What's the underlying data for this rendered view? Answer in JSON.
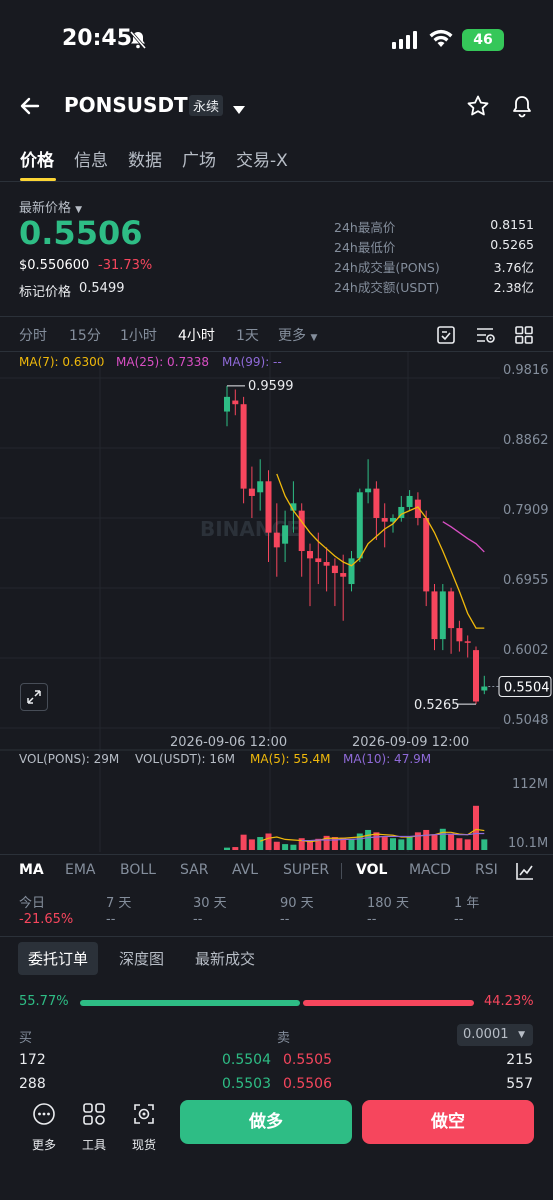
{
  "status_bar": {
    "time": "20:45",
    "battery": "46"
  },
  "header": {
    "symbol": "PONSUSDT",
    "contract_type": "永续"
  },
  "tabs": [
    "价格",
    "信息",
    "数据",
    "广场",
    "交易-X"
  ],
  "price": {
    "label": "最新价格",
    "last": "0.5506",
    "usd": "$0.550600",
    "change": "-31.73%",
    "mark_label": "标记价格",
    "mark_value": "0.5499"
  },
  "stats": [
    {
      "k": "24h最高价",
      "v": "0.8151"
    },
    {
      "k": "24h最低价",
      "v": "0.5265"
    },
    {
      "k": "24h成交量(PONS)",
      "v": "3.76亿"
    },
    {
      "k": "24h成交额(USDT)",
      "v": "2.38亿"
    }
  ],
  "intervals": [
    "分时",
    "15分",
    "1小时",
    "4小时",
    "1天",
    "更多"
  ],
  "active_interval": "4小时",
  "ma_legend": {
    "ma7": "MA(7): 0.6300",
    "ma25": "MA(25): 0.7338",
    "ma99": "MA(99): --"
  },
  "chart": {
    "y_ticks": [
      "0.9816",
      "0.8862",
      "0.7909",
      "0.6955",
      "0.6002",
      "0.5048"
    ],
    "high_label": "0.9599",
    "low_label": "0.5265",
    "current_tag": "0.5504",
    "x_labels": [
      "2026-09-06 12:00",
      "2026-09-09 12:00"
    ],
    "watermark": "BINANCE",
    "vol_ticks": [
      "112M",
      "10.1M"
    ]
  },
  "vol_legend": {
    "pons": "VOL(PONS): 29M",
    "usdt": "VOL(USDT): 16M",
    "ma5": "MA(5): 55.4M",
    "ma10": "MA(10): 47.9M"
  },
  "indicators": [
    "MA",
    "EMA",
    "BOLL",
    "SAR",
    "AVL",
    "SUPER",
    "VOL",
    "MACD",
    "RSI"
  ],
  "performance": [
    {
      "label": "今日",
      "value": "-21.65%"
    },
    {
      "label": "7 天",
      "value": "--"
    },
    {
      "label": "30 天",
      "value": "--"
    },
    {
      "label": "90 天",
      "value": "--"
    },
    {
      "label": "180 天",
      "value": "--"
    },
    {
      "label": "1 年",
      "value": "--"
    }
  ],
  "orderbook_tabs": [
    "委托订单",
    "深度图",
    "最新成交"
  ],
  "ratio": {
    "buy": "55.77%",
    "sell": "44.23%",
    "buy_fraction": 0.5577
  },
  "book": {
    "buy_header": "买",
    "sell_header": "卖",
    "precision": "0.0001",
    "rows": [
      {
        "bid_qty": "172",
        "bid_price": "0.5504",
        "ask_price": "0.5505",
        "ask_qty": "215"
      },
      {
        "bid_qty": "288",
        "bid_price": "0.5503",
        "ask_price": "0.5506",
        "ask_qty": "557"
      }
    ]
  },
  "bottom": {
    "more": "更多",
    "tools": "工具",
    "spot": "现货",
    "long": "做多",
    "short": "做空"
  },
  "colors": {
    "up": "#2ebd85",
    "down": "#f6465d",
    "ma7": "#f0b90b",
    "ma25": "#d94fc4",
    "ma99": "#8f6ad8",
    "accent": "#fcd535"
  },
  "chart_data": {
    "type": "candlestick",
    "y_range": [
      0.5048,
      0.9816
    ],
    "candles": [
      {
        "o": 0.925,
        "c": 0.945,
        "h": 0.96,
        "l": 0.905
      },
      {
        "o": 0.94,
        "c": 0.935,
        "h": 0.955,
        "l": 0.92
      },
      {
        "o": 0.935,
        "c": 0.82,
        "h": 0.945,
        "l": 0.8
      },
      {
        "o": 0.82,
        "c": 0.81,
        "h": 0.85,
        "l": 0.78
      },
      {
        "o": 0.815,
        "c": 0.83,
        "h": 0.86,
        "l": 0.79
      },
      {
        "o": 0.83,
        "c": 0.76,
        "h": 0.845,
        "l": 0.72
      },
      {
        "o": 0.76,
        "c": 0.74,
        "h": 0.8,
        "l": 0.7
      },
      {
        "o": 0.745,
        "c": 0.77,
        "h": 0.79,
        "l": 0.72
      },
      {
        "o": 0.79,
        "c": 0.8,
        "h": 0.83,
        "l": 0.76
      },
      {
        "o": 0.79,
        "c": 0.735,
        "h": 0.8,
        "l": 0.7
      },
      {
        "o": 0.735,
        "c": 0.725,
        "h": 0.745,
        "l": 0.66
      },
      {
        "o": 0.725,
        "c": 0.72,
        "h": 0.76,
        "l": 0.69
      },
      {
        "o": 0.72,
        "c": 0.715,
        "h": 0.74,
        "l": 0.68
      },
      {
        "o": 0.715,
        "c": 0.705,
        "h": 0.725,
        "l": 0.66
      },
      {
        "o": 0.705,
        "c": 0.7,
        "h": 0.73,
        "l": 0.64
      },
      {
        "o": 0.69,
        "c": 0.725,
        "h": 0.735,
        "l": 0.68
      },
      {
        "o": 0.725,
        "c": 0.815,
        "h": 0.82,
        "l": 0.72
      },
      {
        "o": 0.815,
        "c": 0.82,
        "h": 0.86,
        "l": 0.8
      },
      {
        "o": 0.82,
        "c": 0.78,
        "h": 0.83,
        "l": 0.75
      },
      {
        "o": 0.78,
        "c": 0.775,
        "h": 0.8,
        "l": 0.74
      },
      {
        "o": 0.775,
        "c": 0.78,
        "h": 0.785,
        "l": 0.76
      },
      {
        "o": 0.78,
        "c": 0.795,
        "h": 0.81,
        "l": 0.775
      },
      {
        "o": 0.795,
        "c": 0.81,
        "h": 0.818,
        "l": 0.79
      },
      {
        "o": 0.805,
        "c": 0.78,
        "h": 0.815,
        "l": 0.77
      },
      {
        "o": 0.78,
        "c": 0.68,
        "h": 0.79,
        "l": 0.66
      },
      {
        "o": 0.68,
        "c": 0.615,
        "h": 0.69,
        "l": 0.6
      },
      {
        "o": 0.615,
        "c": 0.68,
        "h": 0.69,
        "l": 0.6
      },
      {
        "o": 0.68,
        "c": 0.63,
        "h": 0.685,
        "l": 0.595
      },
      {
        "o": 0.63,
        "c": 0.612,
        "h": 0.64,
        "l": 0.598
      },
      {
        "o": 0.612,
        "c": 0.61,
        "h": 0.62,
        "l": 0.59
      },
      {
        "o": 0.6,
        "c": 0.53,
        "h": 0.605,
        "l": 0.5265
      },
      {
        "o": 0.545,
        "c": 0.5504,
        "h": 0.565,
        "l": 0.54
      }
    ],
    "ma7": [
      null,
      null,
      null,
      null,
      null,
      null,
      0.84,
      0.81,
      0.79,
      0.775,
      0.76,
      0.748,
      0.738,
      0.728,
      0.72,
      0.715,
      0.725,
      0.745,
      0.755,
      0.765,
      0.772,
      0.785,
      0.79,
      0.795,
      0.78,
      0.76,
      0.735,
      0.708,
      0.68,
      0.65,
      0.63,
      0.63
    ],
    "ma25": [
      null,
      null,
      null,
      null,
      null,
      null,
      null,
      null,
      null,
      null,
      null,
      null,
      null,
      null,
      null,
      null,
      null,
      null,
      null,
      null,
      null,
      null,
      null,
      null,
      null,
      null,
      0.775,
      0.768,
      0.76,
      0.752,
      0.745,
      0.7338
    ],
    "volume": [
      4,
      5,
      26,
      18,
      22,
      28,
      14,
      10,
      9,
      20,
      15,
      19,
      24,
      22,
      21,
      18,
      28,
      34,
      30,
      22,
      20,
      18,
      22,
      30,
      34,
      26,
      36,
      28,
      20,
      18,
      75,
      18
    ],
    "vol_ma5": [
      null,
      null,
      null,
      null,
      15,
      20,
      22,
      18,
      17,
      16,
      14,
      16,
      20,
      20,
      20,
      21,
      22,
      25,
      27,
      26,
      25,
      22,
      22,
      24,
      25,
      26,
      30,
      30,
      27,
      26,
      35,
      33
    ],
    "vol_ma10": [
      null,
      null,
      null,
      null,
      null,
      null,
      null,
      null,
      null,
      16,
      16,
      17,
      17,
      17,
      18,
      18,
      19,
      21,
      22,
      23,
      23,
      23,
      23,
      24,
      25,
      26,
      27,
      27,
      26,
      26,
      28,
      28
    ],
    "vol_range": [
      0,
      112
    ]
  }
}
